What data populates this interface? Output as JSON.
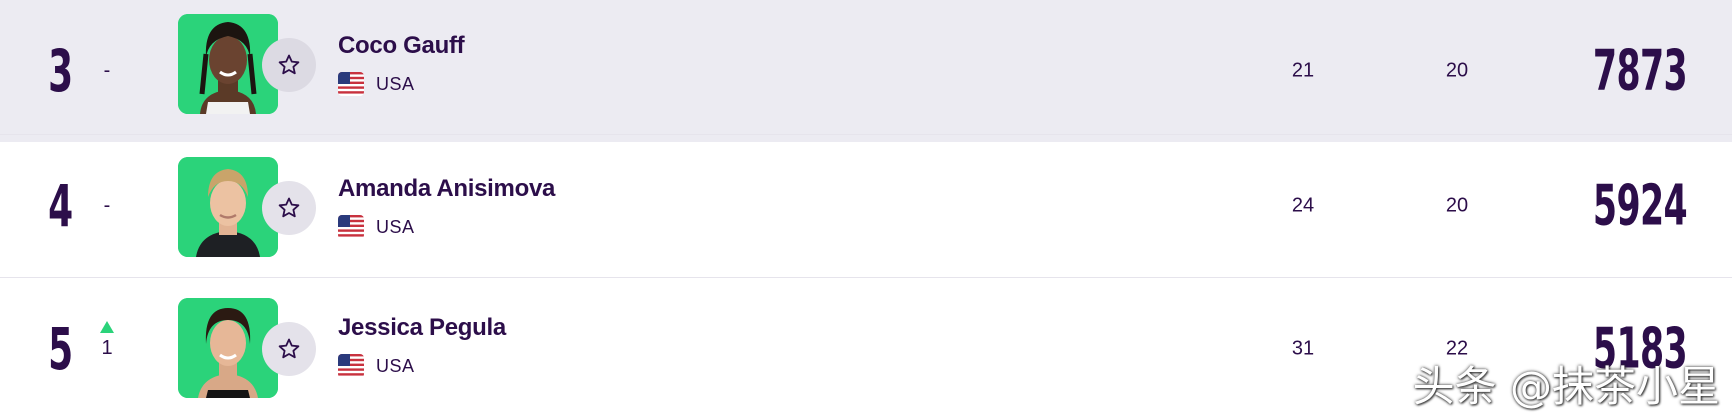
{
  "rows": [
    {
      "rank": "3",
      "movement": "-",
      "movement_dir": "none",
      "name": "Coco Gauff",
      "country": "USA",
      "age": "21",
      "tournaments": "20",
      "points": "7873",
      "favorite_icon": "star-outline-icon",
      "highlighted": true
    },
    {
      "rank": "4",
      "movement": "-",
      "movement_dir": "none",
      "name": "Amanda Anisimova",
      "country": "USA",
      "age": "24",
      "tournaments": "20",
      "points": "5924",
      "favorite_icon": "star-outline-icon",
      "highlighted": false
    },
    {
      "rank": "5",
      "movement": "1",
      "movement_dir": "up",
      "name": "Jessica Pegula",
      "country": "USA",
      "age": "31",
      "tournaments": "22",
      "points": "5183",
      "favorite_icon": "star-outline-icon",
      "highlighted": false
    }
  ],
  "watermark": "头条 @抹茶小星",
  "colors": {
    "primary_text": "#2c0e4a",
    "highlight_row_bg": "#ecebf2",
    "avatar_bg": "#2bd37a",
    "up_arrow": "#2bd37a"
  }
}
